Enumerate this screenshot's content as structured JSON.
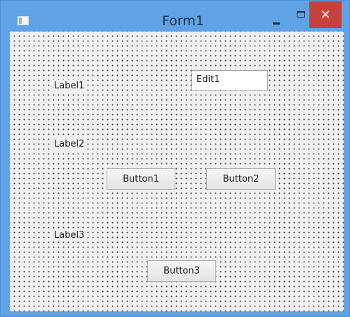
{
  "window": {
    "title": "Form1",
    "close_glyph": "✕",
    "title_color": "#1e2f44",
    "frame_color": "#5fa3e6",
    "close_color": "#c7413a"
  },
  "form": {
    "labels": [
      "Label1",
      "Label2",
      "Label3"
    ],
    "edit_value": "Edit1",
    "buttons": [
      "Button1",
      "Button2",
      "Button3"
    ],
    "grid_style": "dotted-design-grid"
  }
}
